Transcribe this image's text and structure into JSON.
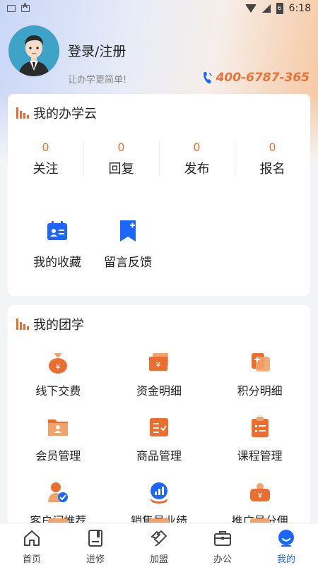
{
  "status_bar": {
    "time": "6:18",
    "battery_level": "6"
  },
  "profile": {
    "login_label": "登录/注册",
    "slogan": "让办学更简单!",
    "phone": "400-6787-365"
  },
  "section1": {
    "title": "我的办学云",
    "stats": [
      {
        "count": "0",
        "label": "关注"
      },
      {
        "count": "0",
        "label": "回复"
      },
      {
        "count": "0",
        "label": "发布"
      },
      {
        "count": "0",
        "label": "报名"
      }
    ],
    "shortcuts": [
      {
        "label": "我的收藏",
        "icon": "id-card-icon"
      },
      {
        "label": "留言反馈",
        "icon": "bookmark-plus-icon"
      }
    ]
  },
  "section2": {
    "title": "我的团学",
    "items": [
      {
        "label": "线下交费",
        "icon": "money-bag-icon"
      },
      {
        "label": "资金明细",
        "icon": "wallet-icon"
      },
      {
        "label": "积分明细",
        "icon": "points-icon"
      },
      {
        "label": "会员管理",
        "icon": "member-folder-icon"
      },
      {
        "label": "商品管理",
        "icon": "goods-list-icon"
      },
      {
        "label": "课程管理",
        "icon": "clipboard-icon"
      },
      {
        "label": "客户间推荐",
        "icon": "user-check-icon"
      },
      {
        "label": "销售员业绩",
        "icon": "sales-chart-icon"
      },
      {
        "label": "推广员分佣",
        "icon": "commission-icon"
      }
    ]
  },
  "tabbar": {
    "tabs": [
      {
        "label": "首页",
        "icon": "home-icon"
      },
      {
        "label": "进修",
        "icon": "book-icon"
      },
      {
        "label": "加盟",
        "icon": "handshake-icon"
      },
      {
        "label": "办公",
        "icon": "briefcase-icon"
      },
      {
        "label": "我的",
        "icon": "user-icon",
        "active": true
      }
    ]
  },
  "colors": {
    "accent": "#e8733a",
    "active_tab": "#1a66ff",
    "icon_blue": "#1a66ff"
  }
}
